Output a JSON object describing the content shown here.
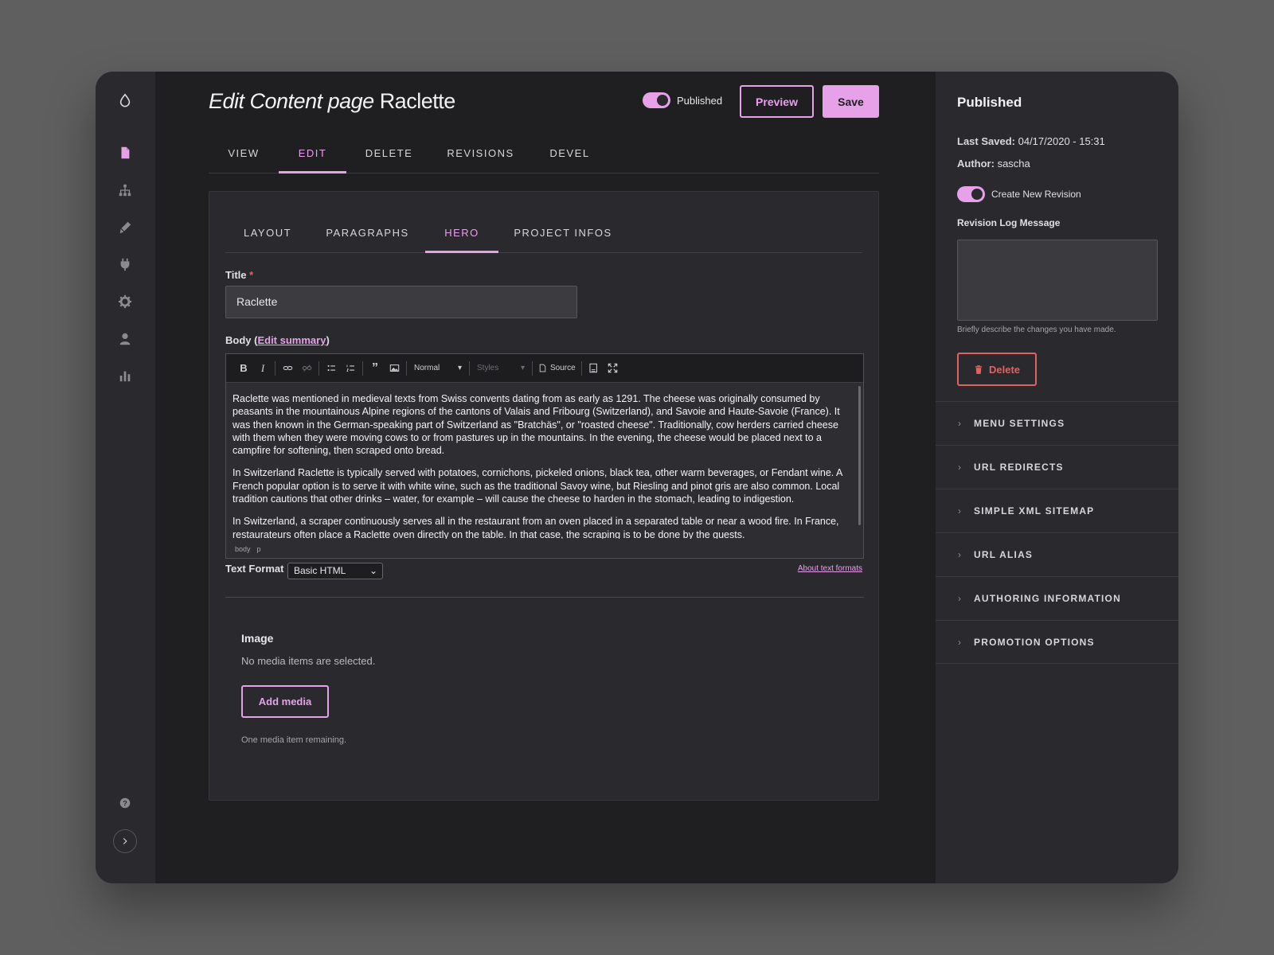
{
  "page": {
    "title_prefix": "Edit Content page",
    "title_name": "Raclette",
    "published_label": "Published",
    "preview_label": "Preview",
    "save_label": "Save"
  },
  "tabs": [
    "VIEW",
    "EDIT",
    "DELETE",
    "REVISIONS",
    "DEVEL"
  ],
  "active_tab": "EDIT",
  "subtabs": [
    "LAYOUT",
    "PARAGRAPHS",
    "HERO",
    "PROJECT INFOS"
  ],
  "active_subtab": "HERO",
  "form": {
    "title_label": "Title",
    "title_required": "*",
    "title_value": "Raclette",
    "body_label": "Body (",
    "body_link": "Edit summary",
    "body_label_end": ")",
    "toolbar": {
      "format_select": "Normal",
      "styles_select": "Styles",
      "source_label": "Source"
    },
    "body_paragraphs": [
      "Raclette was mentioned in medieval texts from Swiss convents dating from as early as 1291. The cheese was originally consumed by peasants in the mountainous Alpine regions of the cantons of Valais and Fribourg (Switzerland), and Savoie and Haute-Savoie (France). It was then known in the German-speaking part of Switzerland as \"Bratchäs\", or \"roasted cheese\". Traditionally, cow herders carried cheese with them when they were moving cows to or from pastures up in the mountains. In the evening, the cheese would be placed next to a campfire for softening, then scraped onto bread.",
      "In Switzerland Raclette is typically served with potatoes, cornichons, pickeled onions, black tea, other warm beverages, or Fendant wine. A French popular option is to serve it with white wine, such as the traditional Savoy wine, but Riesling and pinot gris are also common. Local tradition cautions that other drinks – water, for example – will cause the cheese to harden in the stomach, leading to indigestion.",
      "In Switzerland, a scraper continuously serves all in the restaurant from an oven placed in a separated table or near a wood fire. In France, restaurateurs often place a Raclette oven directly on the table. In that case, the scraping is to be done by the guests."
    ],
    "path": [
      "body",
      "p"
    ],
    "text_format_label": "Text Format",
    "text_format_value": "Basic HTML",
    "about_formats": "About text formats",
    "image_title": "Image",
    "image_empty": "No media items are selected.",
    "add_media": "Add media",
    "media_remaining": "One media item remaining."
  },
  "sidebar": {
    "status": "Published",
    "last_saved_label": "Last Saved:",
    "last_saved_value": "04/17/2020 - 15:31",
    "author_label": "Author:",
    "author_value": "sascha",
    "create_revision": "Create New Revision",
    "revision_log_label": "Revision Log Message",
    "revision_log_value": "",
    "revision_help": "Briefly describe the changes you have made.",
    "delete_label": "Delete",
    "sections": [
      "MENU SETTINGS",
      "URL REDIRECTS",
      "SIMPLE XML SITEMAP",
      "URL ALIAS",
      "AUTHORING INFORMATION",
      "PROMOTION OPTIONS"
    ]
  },
  "colors": {
    "accent": "#e6a1e9",
    "danger": "#e0635e"
  },
  "nav_icons": [
    "drop-logo-icon",
    "content-icon",
    "structure-icon",
    "appearance-icon",
    "extend-icon",
    "config-icon",
    "people-icon",
    "reports-icon",
    "help-icon",
    "expand-icon"
  ]
}
